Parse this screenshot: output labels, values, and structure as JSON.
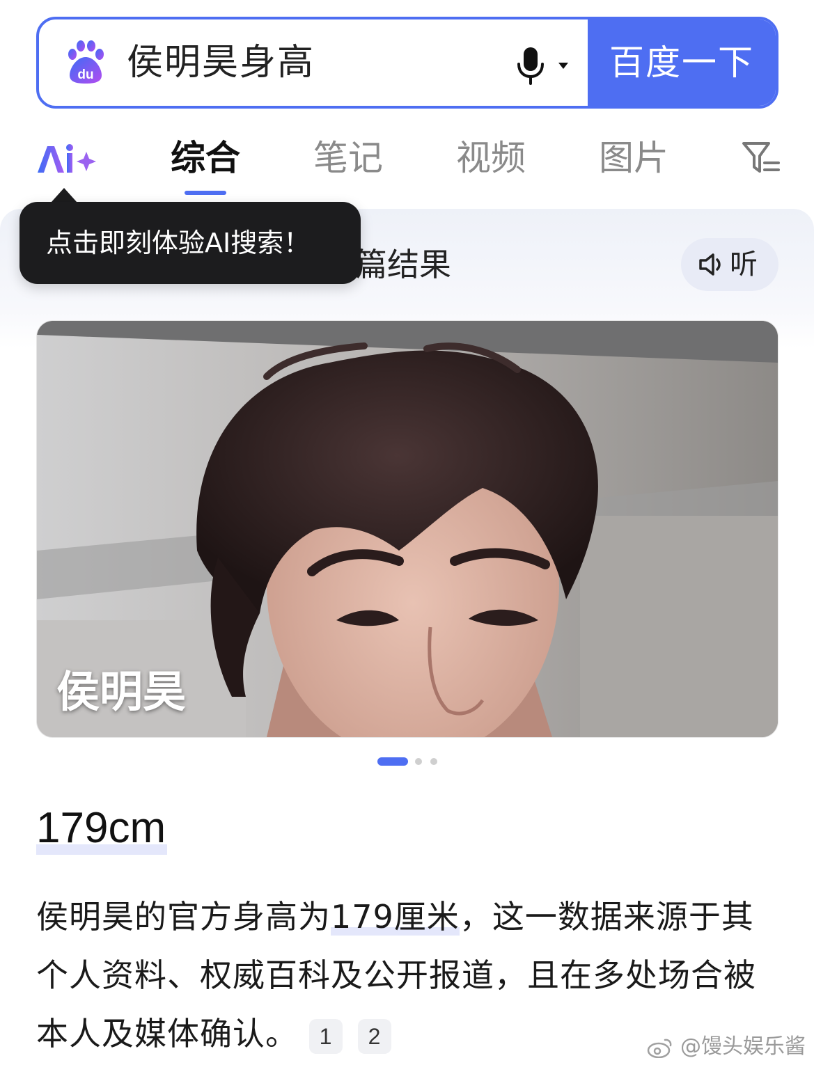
{
  "search": {
    "query": "侯明昊身高",
    "submit_label": "百度一下"
  },
  "tabs": [
    {
      "label": "综合",
      "active": true
    },
    {
      "label": "笔记",
      "active": false
    },
    {
      "label": "视频",
      "active": false
    },
    {
      "label": "图片",
      "active": false
    }
  ],
  "ai_panel": {
    "results_text": "篇结果",
    "listen_label": "听"
  },
  "tooltip": {
    "text": "点击即刻体验AI搜索！"
  },
  "photo": {
    "name_overlay": "侯明昊",
    "carousel_count": 3,
    "carousel_active": 0
  },
  "answer": {
    "value": "179cm",
    "paragraph_before": "侯明昊的官方身高为",
    "paragraph_highlight": "179厘米",
    "paragraph_after": "，这一数据来源于其个人资料、权威百科及公开报道，且在多处场合被本人及媒体确认。",
    "citations": [
      "1",
      "2"
    ]
  },
  "watermark": "@馒头娱乐酱",
  "colors": {
    "accent": "#4e6ef2",
    "tooltip_bg": "#1c1c1e",
    "highlight": "#e4e7fb"
  },
  "icons": [
    "baidu-paw-logo",
    "microphone-icon",
    "dropdown-caret-icon",
    "ai-sparkle-icon",
    "filter-icon",
    "speaker-icon",
    "weibo-icon"
  ]
}
